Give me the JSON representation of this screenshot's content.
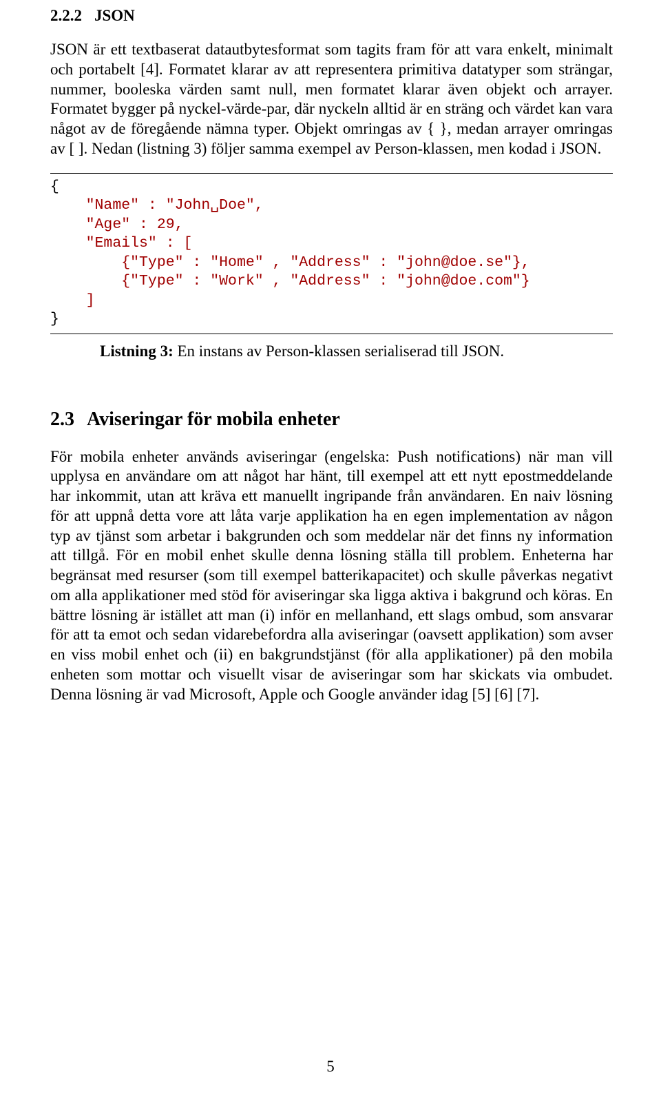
{
  "section222": {
    "number": "2.2.2",
    "title": "JSON",
    "paragraph": "JSON är ett textbaserat datautbytesformat som tagits fram för att vara enkelt, minimalt och portabelt [4]. Formatet klarar av att representera primitiva datatyper som strängar, nummer, booleska värden samt null, men formatet klarar även objekt och arrayer. Formatet bygger på nyckel-värde-par, där nyckeln alltid är en sträng och värdet kan vara något av de föregående nämna typer. Objekt omringas av { }, medan arrayer omringas av [ ]. Nedan (listning 3) följer samma exempel av Person-klassen, men kodad i JSON."
  },
  "listing3": {
    "code_lines": [
      "{",
      "    \"Name\" : \"John␣Doe\",",
      "    \"Age\" : 29,",
      "    \"Emails\" : [",
      "        {\"Type\" : \"Home\" , \"Address\" : \"john@doe.se\"},",
      "        {\"Type\" : \"Work\" , \"Address\" : \"john@doe.com\"}",
      "    ]",
      "}"
    ],
    "caption_label": "Listning 3:",
    "caption_text": " En instans av Person-klassen serialiserad till JSON."
  },
  "section23": {
    "number": "2.3",
    "title": "Aviseringar för mobila enheter",
    "paragraph": "För mobila enheter används aviseringar (engelska: Push notifications) när man vill upplysa en användare om att något har hänt, till exempel att ett nytt epostmeddelande har inkommit, utan att kräva ett manuellt ingripande från användaren. En naiv lösning för att uppnå detta vore att låta varje applikation ha en egen implementation av någon typ av tjänst som arbetar i bakgrunden och som meddelar när det finns ny information att tillgå. För en mobil enhet skulle denna lösning ställa till problem. Enheterna har begränsat med resurser (som till exempel batterikapacitet) och skulle påverkas negativt om alla applikationer med stöd för aviseringar ska ligga aktiva i bakgrund och köras. En bättre lösning är istället att man (i) inför en mellanhand, ett slags ombud, som ansvarar för att ta emot och sedan vidarebefordra alla aviseringar (oavsett applikation) som avser en viss mobil enhet och (ii) en bakgrundstjänst (för alla applikationer) på den mobila enheten som mottar och visuellt visar de aviseringar som har skickats via ombudet. Denna lösning är vad Microsoft, Apple och Google använder idag [5] [6] [7]."
  },
  "page_number": "5"
}
